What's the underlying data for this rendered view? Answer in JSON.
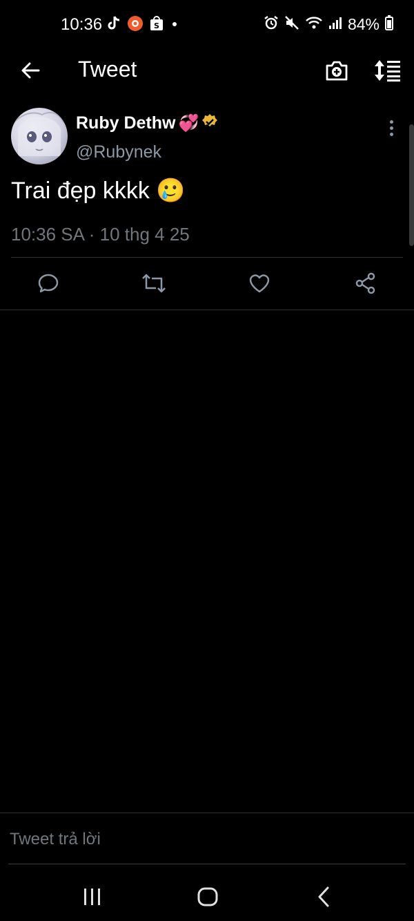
{
  "status_bar": {
    "time": "10:36",
    "battery": "84%",
    "left_icons": [
      "tiktok-icon",
      "recorder-icon",
      "shop-icon",
      "dot-icon"
    ],
    "right_icons": [
      "alarm-icon",
      "mute-icon",
      "wifi-icon",
      "signal-icon",
      "battery-icon"
    ]
  },
  "header": {
    "title": "Tweet",
    "back_icon": "back-arrow-icon",
    "camera_icon": "camera-add-icon",
    "sort_icon": "sort-icon"
  },
  "tweet": {
    "author_name": "Ruby Dethw",
    "name_emoji": "💞",
    "verified_color": "#e8b83a",
    "handle": "@Rubynek",
    "text": "Trai đẹp kkkk 🥲",
    "meta": "10:36 SA · 10 thg 4 25"
  },
  "actions": [
    "reply-icon",
    "retweet-icon",
    "like-icon",
    "share-icon"
  ],
  "reply": {
    "placeholder": "Tweet trả lời"
  },
  "colors": {
    "background": "#000000",
    "primary_text": "#ffffff",
    "secondary_text": "#8b98a5",
    "meta_text": "#71767b",
    "divider": "#2f3336"
  }
}
